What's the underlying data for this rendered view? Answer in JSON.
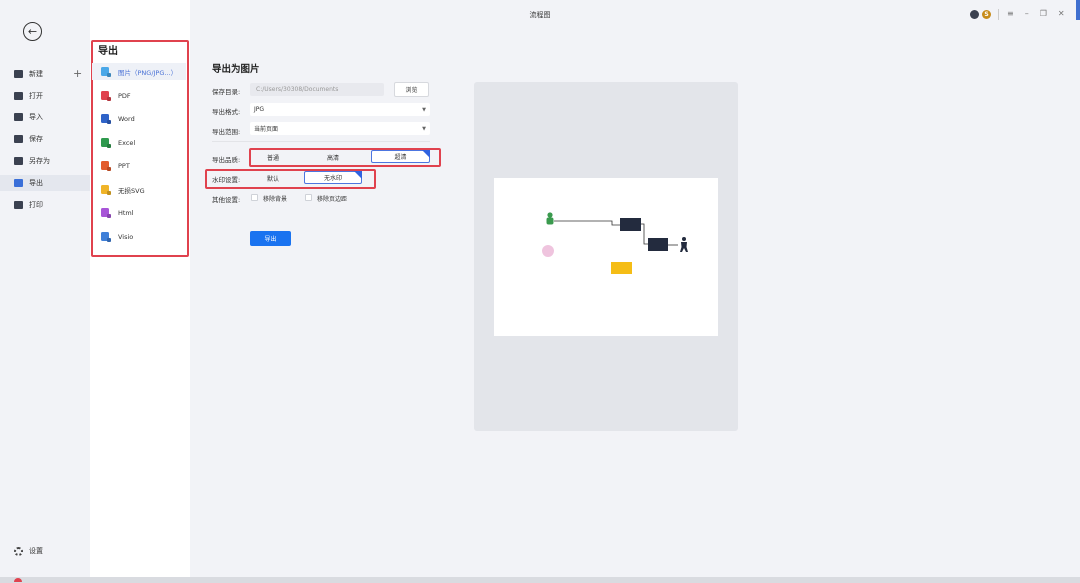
{
  "app_title": "流程图",
  "window_controls": {
    "menu": "≡",
    "minimize": "–",
    "restore": "❐",
    "close": "✕"
  },
  "user_badge": "S",
  "nav": {
    "back_icon": "←",
    "new_plus": "+",
    "items": [
      {
        "label": "新建",
        "icon": "new-file-icon"
      },
      {
        "label": "打开",
        "icon": "folder-icon"
      },
      {
        "label": "导入",
        "icon": "import-icon"
      },
      {
        "label": "保存",
        "icon": "save-icon"
      },
      {
        "label": "另存为",
        "icon": "save-as-icon"
      },
      {
        "label": "导出",
        "icon": "export-icon",
        "active": true
      },
      {
        "label": "打印",
        "icon": "print-icon"
      }
    ],
    "settings_label": "设置"
  },
  "format_panel": {
    "title": "导出",
    "items": [
      {
        "label": "图片（PNG/JPG...）",
        "color": "#4aa8e8",
        "active": true
      },
      {
        "label": "PDF",
        "color": "#e0424e"
      },
      {
        "label": "Word",
        "color": "#2f63c8"
      },
      {
        "label": "Excel",
        "color": "#2f9a4e"
      },
      {
        "label": "PPT",
        "color": "#e35b2b"
      },
      {
        "label": "无损SVG",
        "color": "#f0b428"
      },
      {
        "label": "Html",
        "color": "#a855d8"
      },
      {
        "label": "Visio",
        "color": "#3f7fd8"
      }
    ]
  },
  "export": {
    "section_title": "导出为图片",
    "save_dir_label": "保存目录:",
    "save_dir_value": "C:/Users/30308/Documents",
    "browse_label": "浏览",
    "format_label": "导出格式:",
    "format_value": "JPG",
    "range_label": "导出范围:",
    "range_value": "当前页面",
    "quality_label": "导出品质:",
    "quality_options": [
      "普通",
      "高清",
      "超清"
    ],
    "quality_selected": 2,
    "watermark_label": "水印设置:",
    "watermark_options": [
      "默认",
      "无水印"
    ],
    "watermark_selected": 1,
    "other_label": "其他设置:",
    "other_options": [
      "移除背景",
      "移除页边距"
    ],
    "export_button": "导出"
  },
  "colors": {
    "accent": "#1a73f0",
    "highlight_box": "#e0424e",
    "diagram_dark": "#232b3e",
    "diagram_green": "#3a9a4e",
    "diagram_pink": "#efc4de",
    "diagram_yellow": "#f5bd16"
  }
}
